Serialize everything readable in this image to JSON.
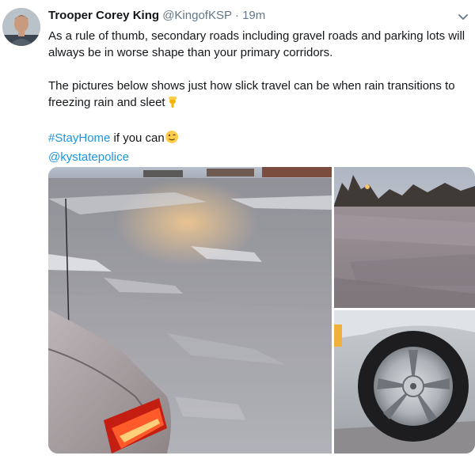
{
  "tweet": {
    "author_name": "Trooper Corey King",
    "handle": "@KingofKSP",
    "separator": "·",
    "time": "19m",
    "text_line1": "As a rule of thumb, secondary roads including gravel roads and parking lots will always be in worse shape than your primary corridors.",
    "text_line2": "The pictures below shows just how slick travel can be when rain transitions to freezing rain and sleet",
    "hashtag": "#StayHome",
    "hashtag_suffix": " if you can",
    "mention": "@kystatepolice",
    "emoji_pointing": "pointing-down-emoji",
    "emoji_wink": "winking-face-emoji"
  },
  "media": {
    "photos": [
      {
        "name": "icy-parking-lot-car-photo"
      },
      {
        "name": "icy-lot-trees-photo"
      },
      {
        "name": "car-wheel-photo"
      }
    ]
  },
  "colors": {
    "link": "#1b95e0",
    "muted": "#657786",
    "text": "#14171a"
  },
  "icons": [
    "caret-down-icon",
    "pointing-down-emoji",
    "winking-face-emoji"
  ]
}
